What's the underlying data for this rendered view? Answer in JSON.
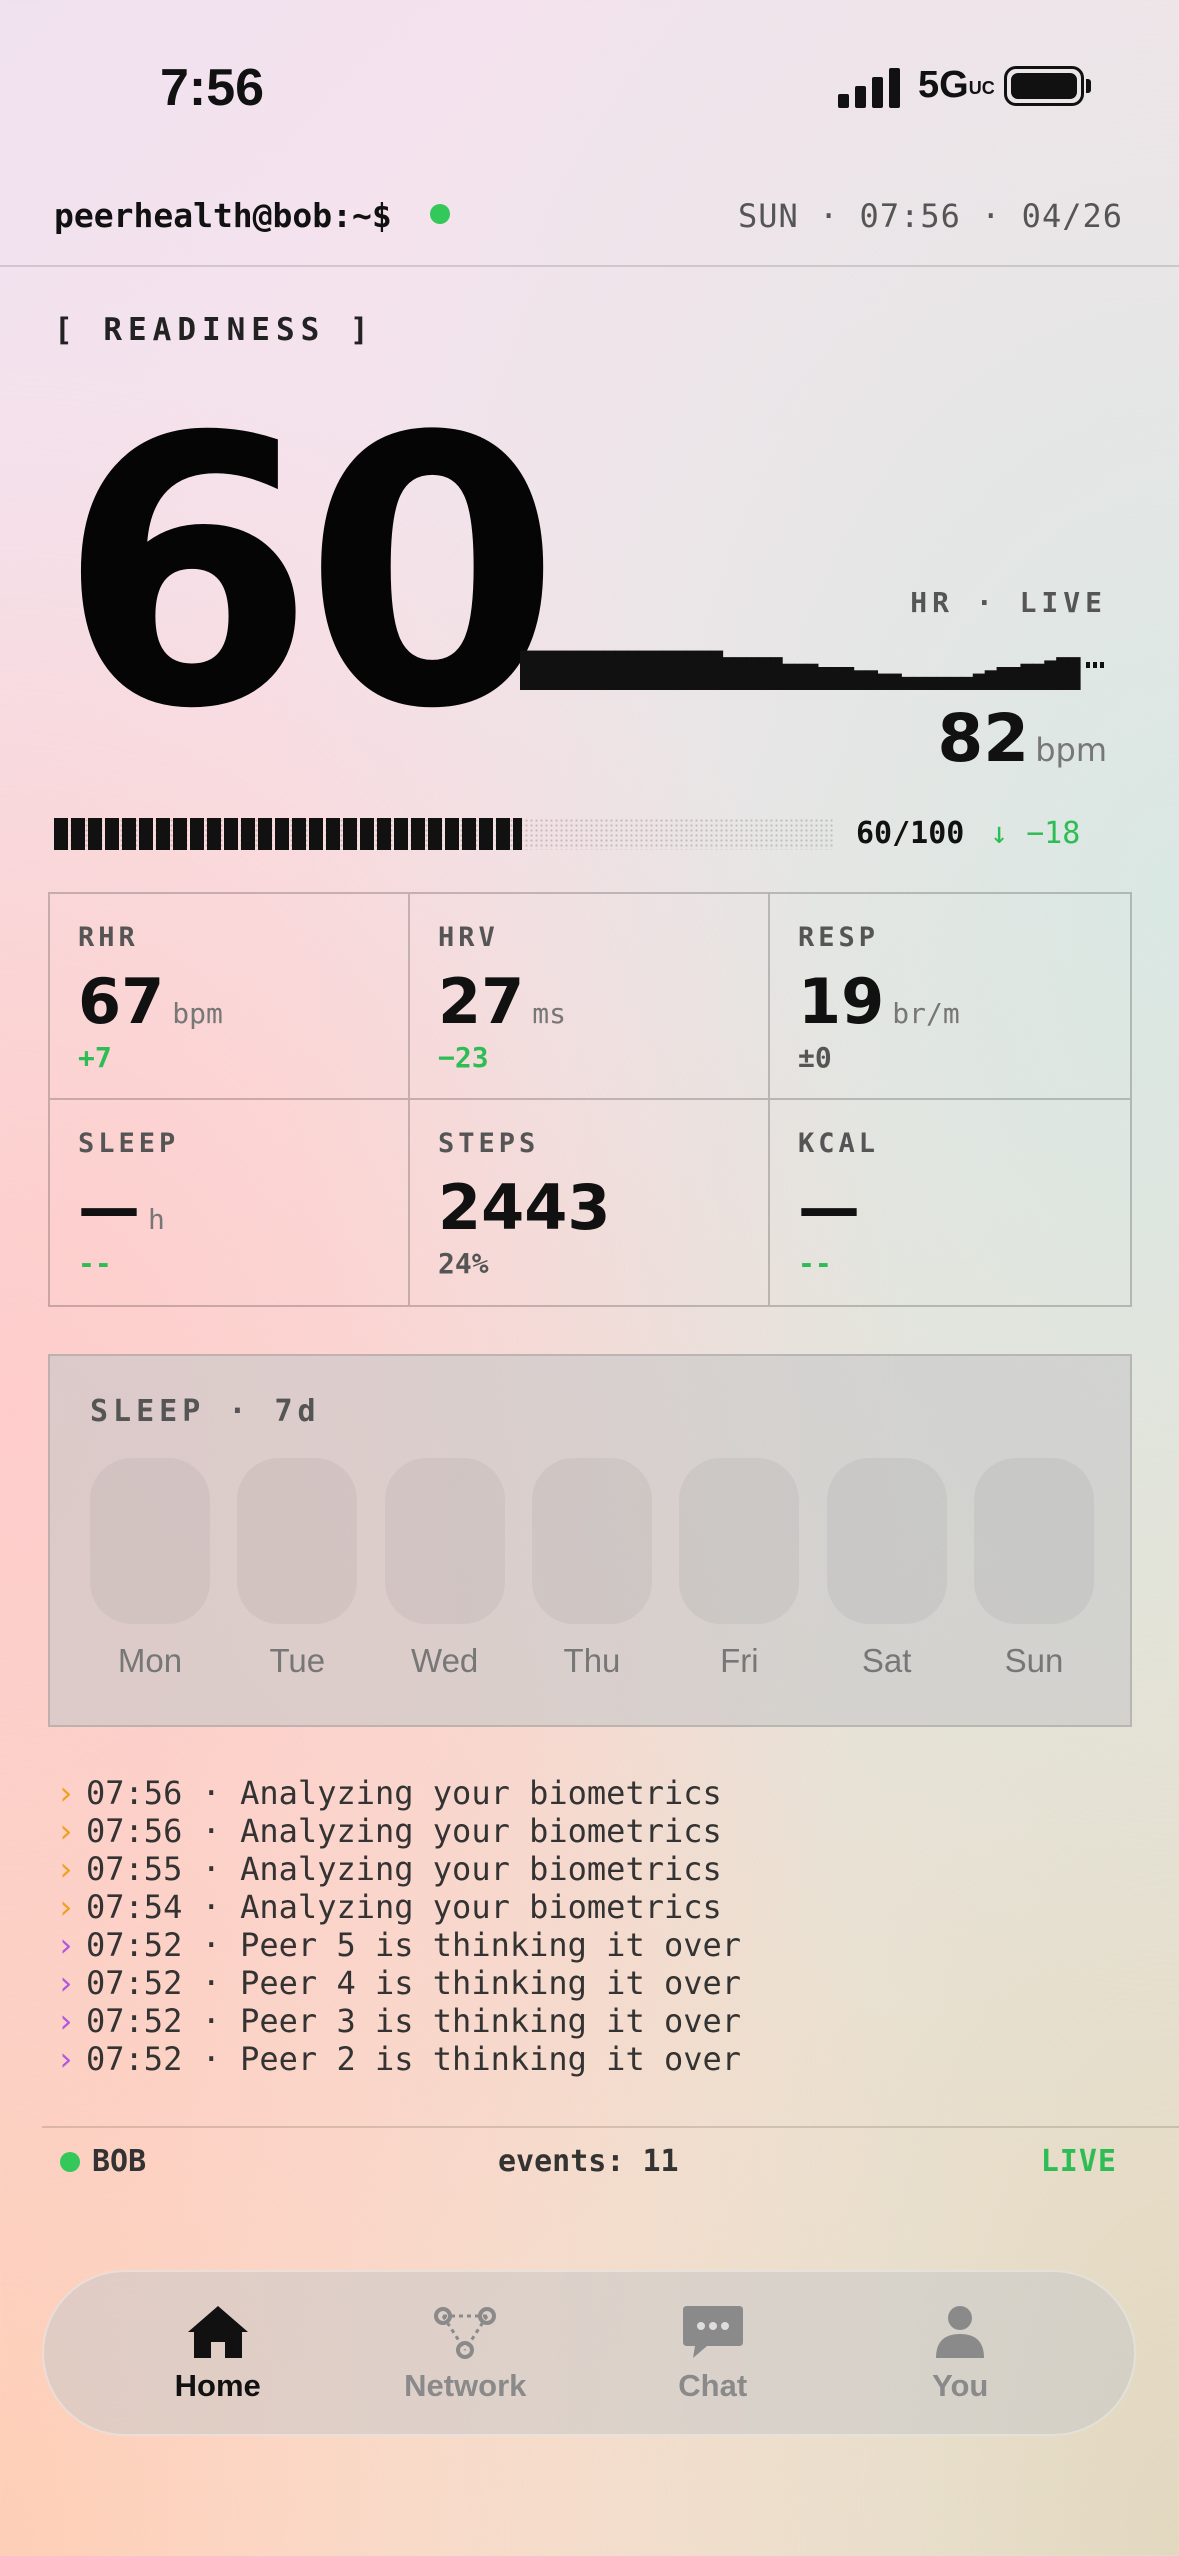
{
  "status_bar": {
    "time": "7:56",
    "network": "5G",
    "network_suffix": "UC"
  },
  "header": {
    "prompt": "peerhealth@bob:~$",
    "datetime": "SUN · 07:56 · 04/26"
  },
  "readiness": {
    "label": "[ READINESS ]",
    "score": "60",
    "score_fraction": 0.6,
    "progress_text": "60/100",
    "delta": "↓ −18"
  },
  "heart_rate": {
    "label": "HR · LIVE",
    "value": "82",
    "unit": "bpm",
    "trace": [
      88,
      88,
      88,
      88,
      88,
      88,
      88,
      88,
      88,
      88,
      88,
      88,
      88,
      88,
      88,
      88,
      88,
      86,
      86,
      86,
      86,
      86,
      84,
      84,
      84,
      83,
      83,
      83,
      82,
      82,
      81,
      81,
      80,
      80,
      80,
      80,
      80,
      80,
      81,
      82,
      83,
      83,
      84,
      84,
      85,
      86,
      86
    ]
  },
  "metrics": [
    {
      "label": "RHR",
      "value": "67",
      "unit": "bpm",
      "delta": "+7",
      "delta_style": "good"
    },
    {
      "label": "HRV",
      "value": "27",
      "unit": "ms",
      "delta": "−23",
      "delta_style": "good"
    },
    {
      "label": "RESP",
      "value": "19",
      "unit": "br/m",
      "delta": "±0",
      "delta_style": "neutral"
    },
    {
      "label": "SLEEP",
      "value": "—",
      "unit": "h",
      "delta": "--",
      "delta_style": "good"
    },
    {
      "label": "STEPS",
      "value": "2443",
      "unit": "",
      "delta": "24%",
      "delta_style": "neutral"
    },
    {
      "label": "KCAL",
      "value": "—",
      "unit": "",
      "delta": "--",
      "delta_style": "good"
    }
  ],
  "sleep": {
    "label": "SLEEP · 7d",
    "days": [
      "Mon",
      "Tue",
      "Wed",
      "Thu",
      "Fri",
      "Sat",
      "Sun"
    ]
  },
  "log": [
    {
      "caret": "›",
      "color": "orange",
      "text": "07:56 · Analyzing your biometrics"
    },
    {
      "caret": "›",
      "color": "orange",
      "text": "07:56 · Analyzing your biometrics"
    },
    {
      "caret": "›",
      "color": "orange",
      "text": "07:55 · Analyzing your biometrics"
    },
    {
      "caret": "›",
      "color": "orange",
      "text": "07:54 · Analyzing your biometrics"
    },
    {
      "caret": "›",
      "color": "purple",
      "text": "07:52 · Peer 5 is thinking it over"
    },
    {
      "caret": "›",
      "color": "purple",
      "text": "07:52 · Peer 4 is thinking it over"
    },
    {
      "caret": "›",
      "color": "purple",
      "text": "07:52 · Peer 3 is thinking it over"
    },
    {
      "caret": "›",
      "color": "purple",
      "text": "07:52 · Peer 2 is thinking it over"
    }
  ],
  "footer": {
    "user": "BOB",
    "events": "events: 11",
    "live": "LIVE"
  },
  "tabs": [
    {
      "label": "Home",
      "icon": "home-icon",
      "active": true
    },
    {
      "label": "Network",
      "icon": "network-icon",
      "active": false
    },
    {
      "label": "Chat",
      "icon": "chat-icon",
      "active": false
    },
    {
      "label": "You",
      "icon": "person-icon",
      "active": false
    }
  ],
  "colors": {
    "accent_green": "#34c759",
    "delta_green": "#2ebd55",
    "caret_orange": "#f0a020",
    "caret_purple": "#b057e0"
  }
}
